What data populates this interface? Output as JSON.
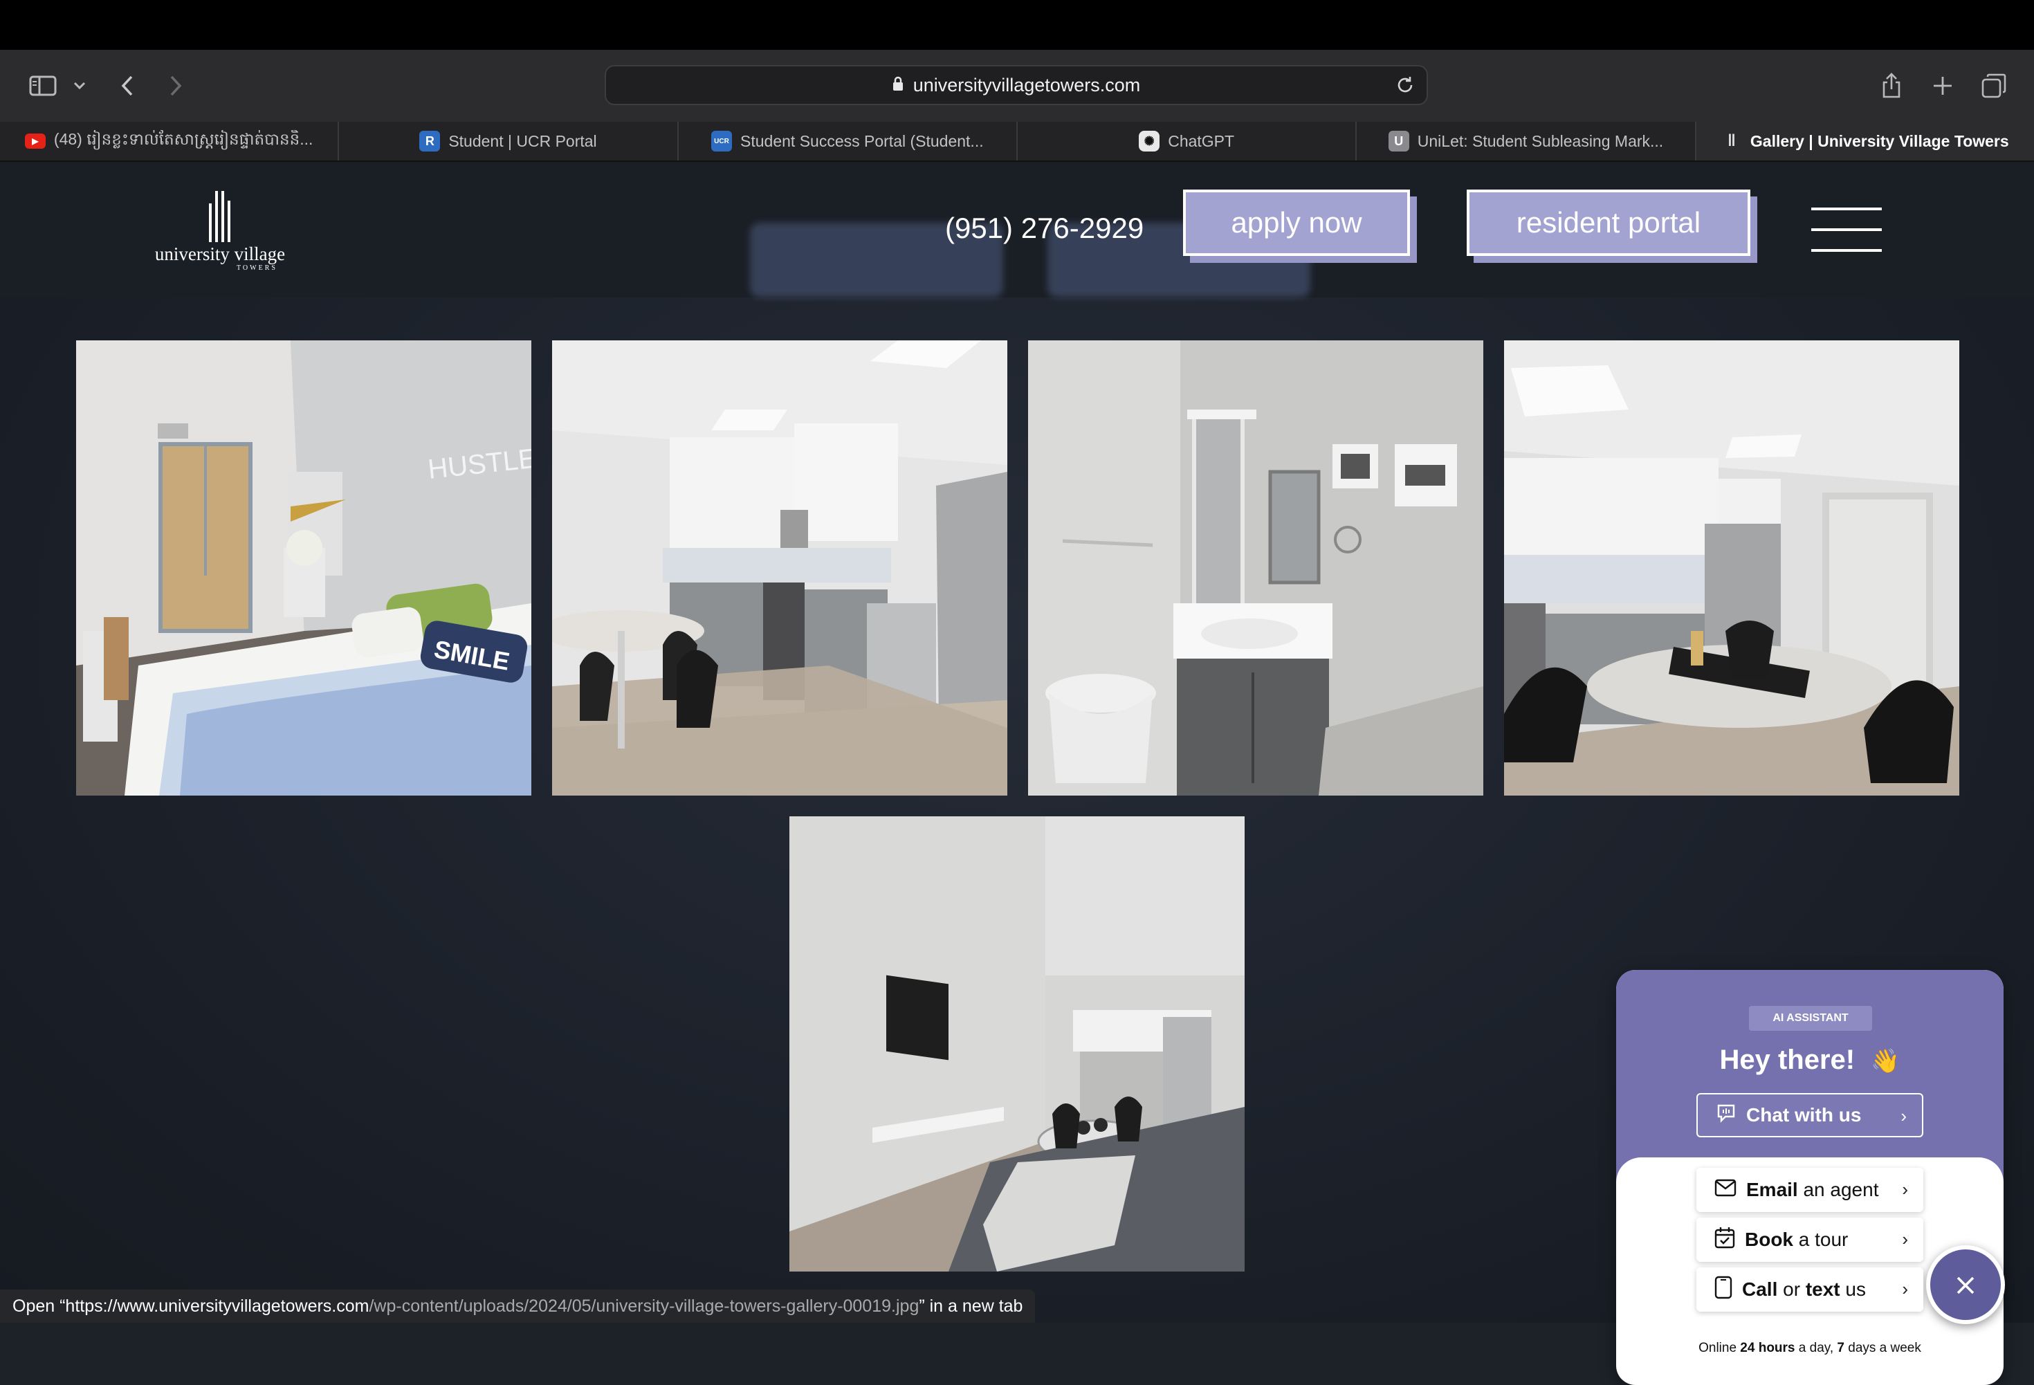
{
  "browser": {
    "url": "universityvillagetowers.com",
    "tabs": [
      {
        "title": "(48) រៀនខ្លះទាល់តែសាស្ត្រ​រៀនផ្ទាត់បាន​និ...",
        "favicon": "youtube-icon",
        "color": "#e62117",
        "glyph": "▶"
      },
      {
        "title": "Student | UCR Portal",
        "favicon": "ucr-r-icon",
        "color": "#2d6cc0",
        "glyph": "R"
      },
      {
        "title": "Student Success Portal (Student...",
        "favicon": "ucr-icon",
        "color": "#2d6cc0",
        "glyph": "UCR"
      },
      {
        "title": "ChatGPT",
        "favicon": "chatgpt-icon",
        "color": "#e8e8e8",
        "glyph": "✺"
      },
      {
        "title": "UniLet: Student Subleasing Mark...",
        "favicon": "unilet-icon",
        "color": "#8a8a8e",
        "glyph": "U"
      },
      {
        "title": "Gallery | University Village Towers",
        "favicon": "uvt-icon",
        "color": "#2c2c2e",
        "glyph": "‖",
        "active": true
      }
    ]
  },
  "site": {
    "logo_text": "university village",
    "logo_sub": "TOWERS",
    "phone": "(951) 276-2929",
    "apply_label": "apply now",
    "portal_label": "resident portal",
    "accent": "#a3a3d1"
  },
  "gallery": {
    "photos": [
      {
        "subject": "bedroom"
      },
      {
        "subject": "kitchen"
      },
      {
        "subject": "bathroom"
      },
      {
        "subject": "kitchen-dining"
      },
      {
        "subject": "living-room"
      }
    ],
    "pillow_text": "SMILE"
  },
  "chat_widget": {
    "badge": "AI ASSISTANT",
    "greeting": "Hey there!",
    "greeting_emoji": "👋",
    "chat_label": "Chat with us",
    "email_bold": "Email",
    "email_rest": " an agent",
    "tour_bold": "Book",
    "tour_rest": " a tour",
    "call_bold": "Call",
    "call_mid": " or ",
    "call_bold2": "text",
    "call_rest": " us",
    "online_pre": "Online ",
    "online_b1": "24 hours",
    "online_mid": " a day, ",
    "online_b2": "7",
    "online_post": " days a week",
    "brand_color": "#7471ae"
  },
  "status_bar": {
    "prefix": "Open “https://www.universityvillagetowers.com",
    "path": "/wp-content/uploads/2024/05/university-village-towers-gallery-00019.jpg",
    "suffix": "” in a new tab"
  }
}
